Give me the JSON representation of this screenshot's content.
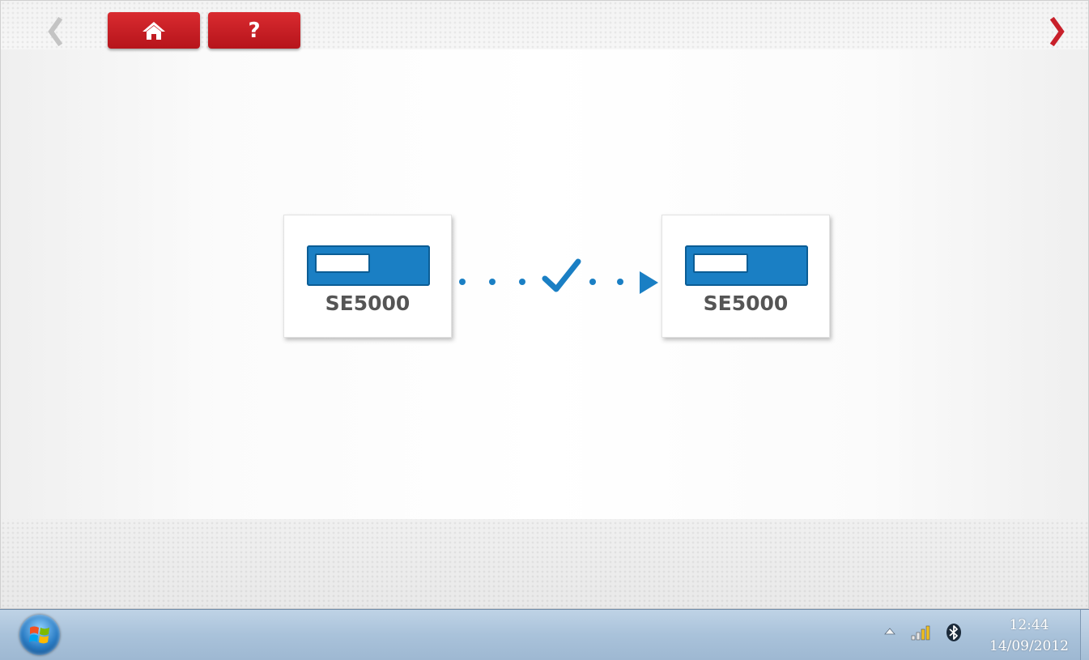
{
  "toolbar": {
    "back_icon": "chevron-left-icon",
    "home_icon": "home-icon",
    "help_label": "?",
    "next_icon": "chevron-right-icon",
    "button_color": "#c8202a",
    "disabled_color": "#c8c8c8"
  },
  "transfer": {
    "source_device": "SE5000",
    "target_device": "SE5000",
    "status_icon": "checkmark-icon",
    "accent_color": "#1a7fc4"
  },
  "taskbar": {
    "start_icon": "windows-start-icon",
    "tray_icons": [
      "show-hidden-icons-icon",
      "signal-strength-icon",
      "bluetooth-icon"
    ],
    "time": "12:44",
    "date": "14/09/2012"
  }
}
